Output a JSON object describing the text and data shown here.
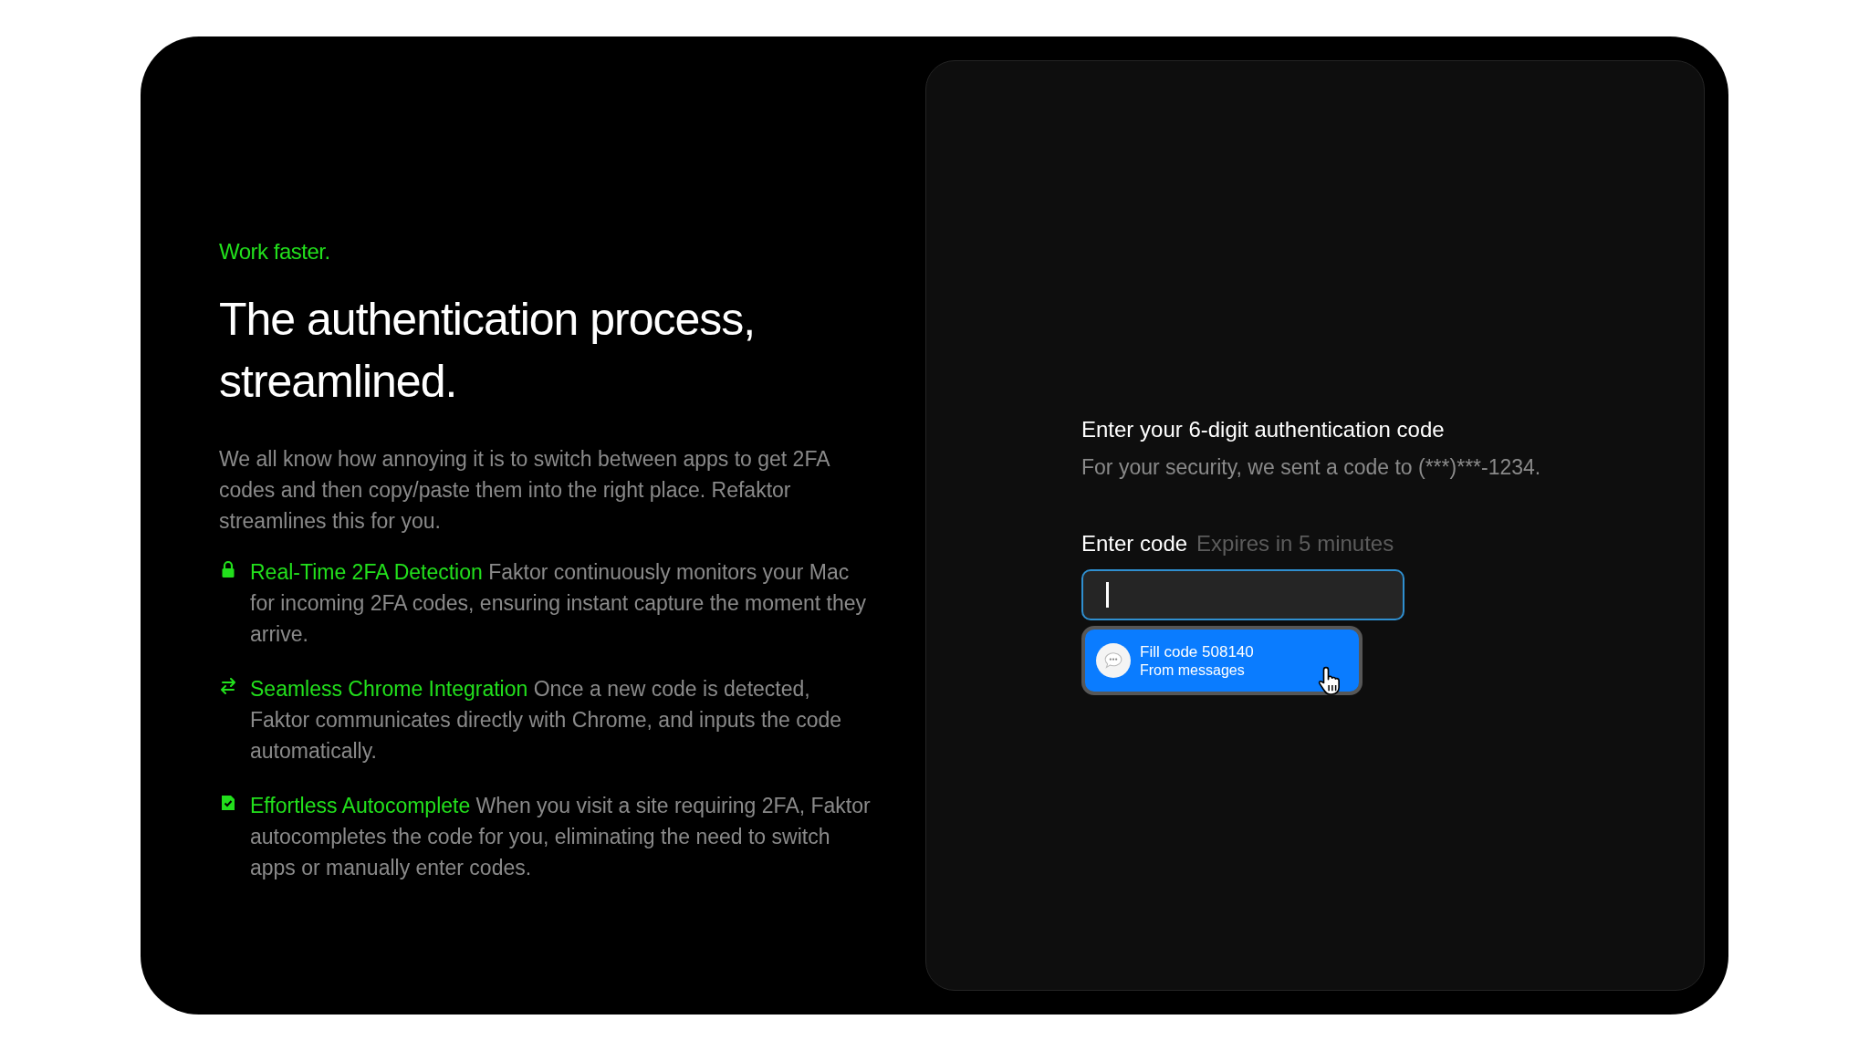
{
  "intro": {
    "eyebrow": "Work faster.",
    "heading": "The authentication process, streamlined.",
    "description": "We all know how annoying it is to switch between apps to get 2FA codes and then copy/paste them into the right place. Refaktor streamlines this for you."
  },
  "features": [
    {
      "kind": "lock",
      "title": "Real-Time 2FA Detection",
      "text": "Faktor continuously monitors your Mac for incoming 2FA codes, ensuring instant capture the moment they arrive."
    },
    {
      "kind": "swap",
      "title": "Seamless Chrome Integration",
      "text": "Once a new code is detected, Faktor communicates directly with Chrome, and inputs the code automatically."
    },
    {
      "kind": "check",
      "title": "Effortless Autocomplete",
      "text": "When you visit a site requiring 2FA, Faktor autocompletes the code for you, eliminating the need to switch apps or manually enter codes."
    }
  ],
  "form": {
    "title": "Enter your 6-digit authentication code",
    "subtitle": "For your security, we sent a code to (***)***-1234.",
    "label": "Enter code",
    "hint": "Expires in 5 minutes",
    "suggestion": {
      "title": "Fill code 508140",
      "source": "From messages"
    }
  }
}
